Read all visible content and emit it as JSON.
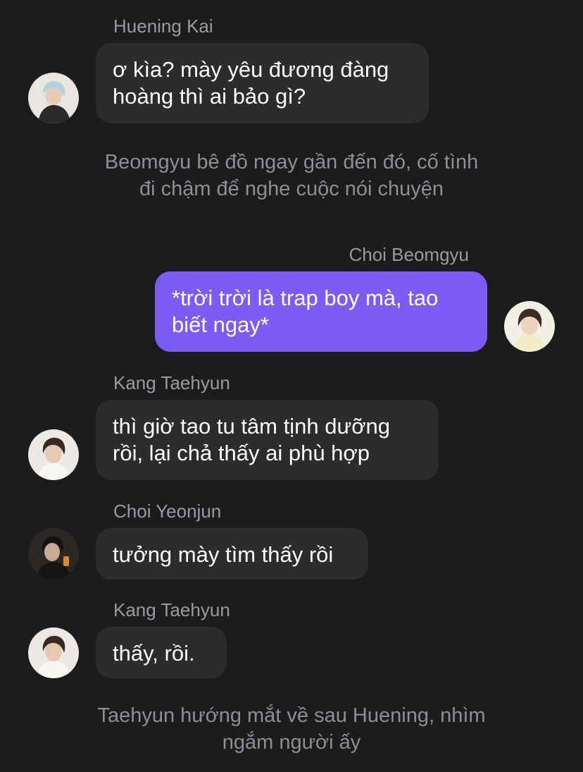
{
  "messages": [
    {
      "sender": "Huening Kai",
      "avatar": "huening-kai-avatar",
      "lines": [
        "ơ kìa? mày yêu đương đàng",
        "hoàng thì ai bảo gì?"
      ]
    },
    {
      "narration": [
        "Beomgyu bê đồ ngay gần đến đó, cố tình",
        "đi chậm để nghe cuộc nói chuyện"
      ]
    },
    {
      "sender": "Choi Beomgyu",
      "avatar": "choi-beomgyu-avatar",
      "lines": [
        "*trời trời là trap boy mà, tao",
        "biết ngay*"
      ]
    },
    {
      "sender": "Kang Taehyun",
      "avatar": "kang-taehyun-avatar",
      "lines": [
        "thì giờ tao tu tâm tịnh dưỡng",
        "rồi, lại chả thấy ai phù hợp"
      ]
    },
    {
      "sender": "Choi Yeonjun",
      "avatar": "choi-yeonjun-avatar",
      "lines": [
        "tưởng mày tìm thấy rồi"
      ]
    },
    {
      "sender": "Kang Taehyun",
      "avatar": "kang-taehyun-avatar",
      "lines": [
        "thấy, rồi."
      ]
    },
    {
      "narration": [
        "Taehyun hướng mắt về sau Huening, nhìm",
        "ngắm người ấy"
      ]
    }
  ],
  "colors": {
    "background": "#1c1c1e",
    "incoming_bubble": "#2c2c2e",
    "outgoing_bubble": "#7b5cf5",
    "sender_name": "#9a9a9f",
    "narration_text": "#8e8e93"
  }
}
